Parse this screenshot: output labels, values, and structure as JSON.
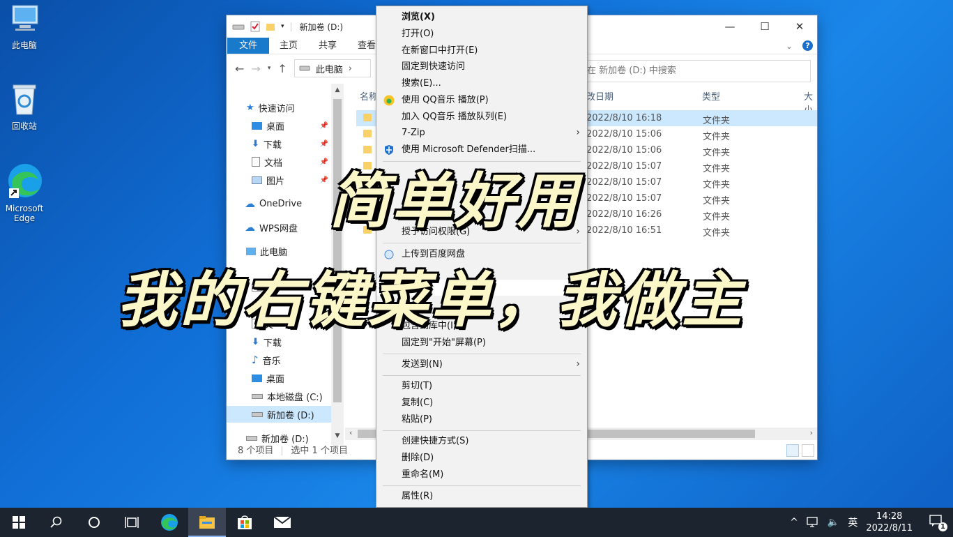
{
  "desktop": {
    "icons": [
      {
        "label": "此电脑",
        "icon": "computer-icon"
      },
      {
        "label": "回收站",
        "icon": "recycle-bin-icon"
      },
      {
        "label": "Microsoft Edge",
        "icon": "edge-icon"
      }
    ]
  },
  "explorer": {
    "title": "新加卷 (D:)",
    "ribbon_tabs": [
      "文件",
      "主页",
      "共享",
      "查看"
    ],
    "breadcrumb": [
      "此电脑"
    ],
    "search_placeholder": "在 新加卷 (D:) 中搜索",
    "nav_items": [
      {
        "label": "快速访问",
        "icon": "star-icon",
        "pinned": false
      },
      {
        "label": "桌面",
        "icon": "desktop-icon",
        "pinned": true
      },
      {
        "label": "下载",
        "icon": "download-icon",
        "pinned": true
      },
      {
        "label": "文档",
        "icon": "document-icon",
        "pinned": true
      },
      {
        "label": "图片",
        "icon": "picture-icon",
        "pinned": true
      },
      {
        "label": "OneDrive",
        "icon": "cloud-icon",
        "pinned": false
      },
      {
        "label": "WPS网盘",
        "icon": "cloud-icon",
        "pinned": false
      },
      {
        "label": "此电脑",
        "icon": "computer-icon",
        "pinned": false
      },
      {
        "label": "视",
        "icon": "video-icon",
        "pinned": false
      },
      {
        "label": "文",
        "icon": "document-icon",
        "pinned": false
      },
      {
        "label": "下载",
        "icon": "download-icon",
        "pinned": false
      },
      {
        "label": "音乐",
        "icon": "music-icon",
        "pinned": false
      },
      {
        "label": "桌面",
        "icon": "desktop-icon",
        "pinned": false
      },
      {
        "label": "本地磁盘 (C:)",
        "icon": "drive-icon",
        "pinned": false
      },
      {
        "label": "新加卷 (D:)",
        "icon": "drive-icon",
        "pinned": false
      },
      {
        "label": "新加卷 (D:)",
        "icon": "drive-icon",
        "pinned": false
      }
    ],
    "columns": {
      "name": "名称",
      "date": "改日期",
      "type": "类型",
      "size": "大小"
    },
    "files": [
      {
        "date": "2022/8/10 16:18",
        "type": "文件夹"
      },
      {
        "date": "2022/8/10 15:06",
        "type": "文件夹"
      },
      {
        "date": "2022/8/10 15:06",
        "type": "文件夹"
      },
      {
        "date": "2022/8/10 15:07",
        "type": "文件夹"
      },
      {
        "date": "2022/8/10 15:07",
        "type": "文件夹"
      },
      {
        "date": "2022/8/10 15:07",
        "type": "文件夹"
      },
      {
        "date": "2022/8/10 16:26",
        "type": "文件夹"
      },
      {
        "date": "2022/8/10 16:51",
        "type": "文件夹"
      }
    ],
    "status_count": "8 个项目",
    "status_selected": "选中 1 个项目"
  },
  "context_menu": [
    {
      "label": "浏览(X)",
      "bold": true
    },
    {
      "label": "打开(O)"
    },
    {
      "label": "在新窗口中打开(E)"
    },
    {
      "label": "固定到快速访问"
    },
    {
      "label": "搜索(E)..."
    },
    {
      "label": "使用 QQ音乐 播放(P)",
      "icon": "qq-music-icon"
    },
    {
      "label": "加入 QQ音乐 播放队列(E)"
    },
    {
      "label": "7-Zip",
      "submenu": true
    },
    {
      "label": "使用 Microsoft Defender扫描...",
      "icon": "defender-shield-icon"
    },
    {
      "label": "授予访问权限(G)",
      "submenu": true
    },
    {
      "label": "上传到百度网盘",
      "icon": "baidu-icon"
    },
    {
      "label": "包含到库中(I)",
      "submenu": true
    },
    {
      "label": "固定到\"开始\"屏幕(P)"
    },
    {
      "label": "发送到(N)",
      "submenu": true
    },
    {
      "label": "剪切(T)"
    },
    {
      "label": "复制(C)"
    },
    {
      "label": "粘贴(P)"
    },
    {
      "label": "创建快捷方式(S)"
    },
    {
      "label": "删除(D)"
    },
    {
      "label": "重命名(M)"
    },
    {
      "label": "属性(R)"
    }
  ],
  "caption": {
    "line1": "简单好用",
    "line2": "我的右键菜单，我做主"
  },
  "taskbar": {
    "apps": [
      "start-icon",
      "search-icon",
      "cortana-icon",
      "task-view-icon",
      "edge-icon",
      "file-explorer-icon",
      "store-icon",
      "mail-icon"
    ],
    "ime": "英",
    "time": "14:28",
    "date": "2022/8/11",
    "notification_count": "1"
  },
  "colors": {
    "accent": "#1979ca",
    "selection": "#cce8ff",
    "taskbar": "#1c2430"
  }
}
